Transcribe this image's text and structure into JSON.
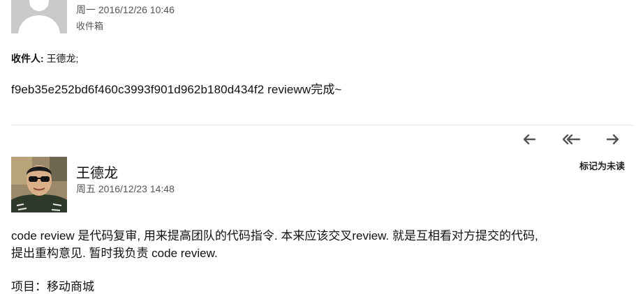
{
  "message1": {
    "date": "周一 2016/12/26 10:46",
    "folder": "收件箱",
    "recipient_label": "收件人:",
    "recipient_value": "王德龙;",
    "body": "f9eb35e252bd6f460c3993f901d962b180d434f2 revieww完成~"
  },
  "actions": {
    "reply_icon": "arrow-left-icon",
    "reply_all_icon": "double-arrow-left-icon",
    "forward_icon": "arrow-right-icon",
    "mark_unread": "标记为未读"
  },
  "message2": {
    "sender": "王德龙",
    "date": "周五 2016/12/23 14:48",
    "body_line1": "code review 是代码复审, 用来提高团队的代码指令. 本来应该交叉review.  就是互相看对方提交的代码,",
    "body_line2": "提出重构意见.  暂时我负责 code review.",
    "body_line3": "项目：移动商城"
  },
  "colors": {
    "icon": "#555555",
    "divider": "#e6e6e6"
  }
}
